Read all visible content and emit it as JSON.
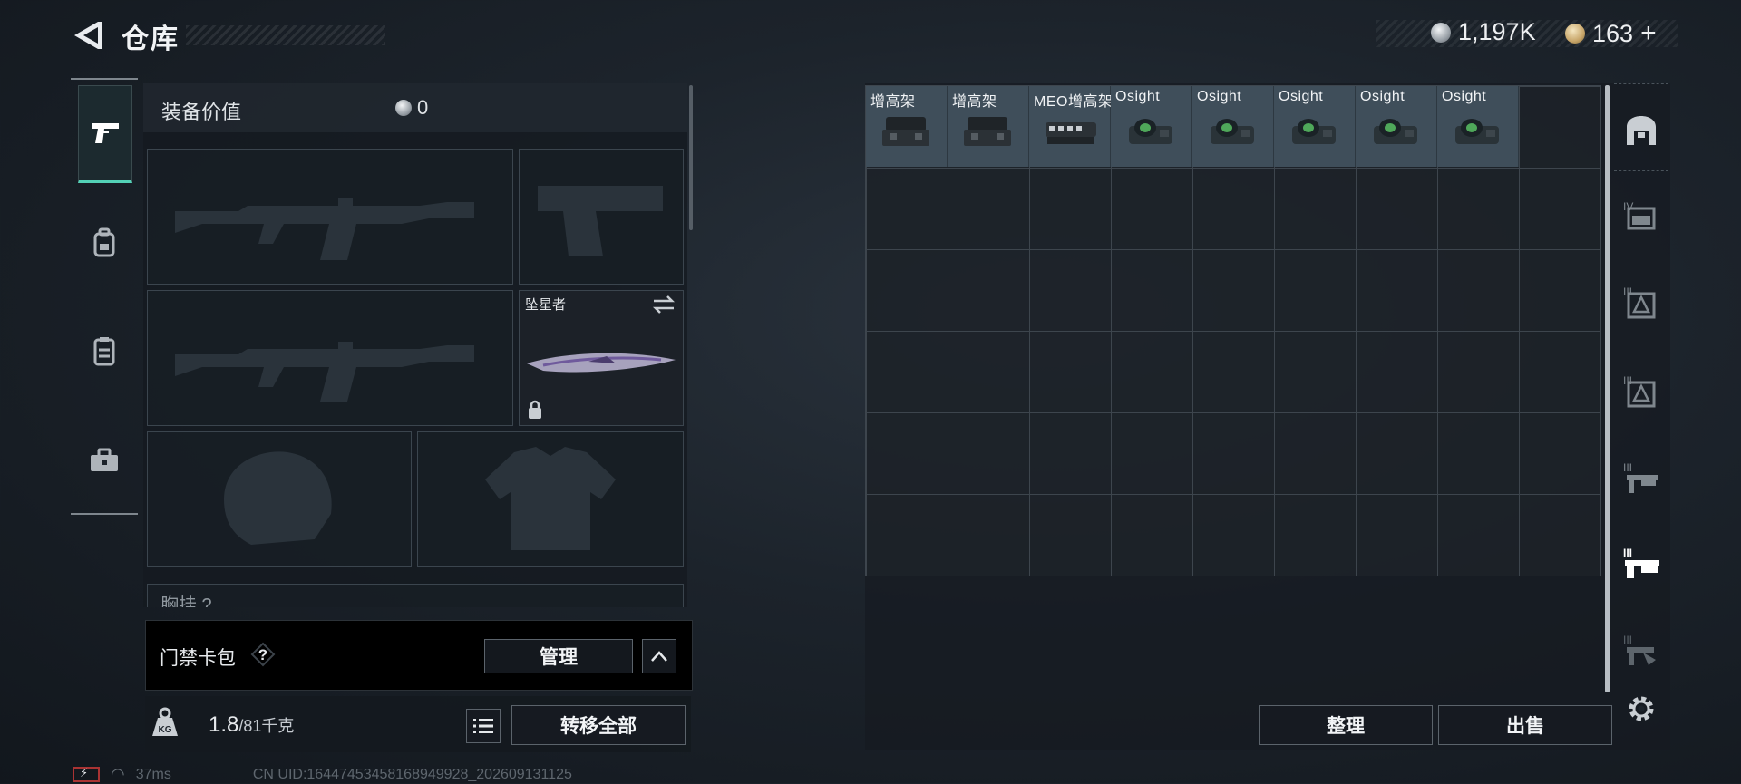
{
  "header": {
    "title": "仓库",
    "currency_silver": "1,197K",
    "currency_gold": "163",
    "gold_plus": "+"
  },
  "equipment": {
    "value_label": "装备价值",
    "value": "0",
    "melee_name": "坠星者",
    "next_section": "胸挂 ?"
  },
  "card_pack": {
    "label": "门禁卡包",
    "help": "?",
    "manage": "管理"
  },
  "weight": {
    "current": "1.8",
    "max": "/81千克",
    "transfer_all": "转移全部"
  },
  "footer": {
    "ping": "37ms",
    "uid": "CN UID:16447453458168949928_202609131125"
  },
  "storage": {
    "items": [
      {
        "name": "增高架",
        "icon": "riser-mount-icon"
      },
      {
        "name": "增高架",
        "icon": "riser-mount-icon"
      },
      {
        "name": "MEO增高架",
        "icon": "meo-riser-icon"
      },
      {
        "name": "Osight",
        "icon": "osight-icon"
      },
      {
        "name": "Osight",
        "icon": "osight-icon"
      },
      {
        "name": "Osight",
        "icon": "osight-icon"
      },
      {
        "name": "Osight",
        "icon": "osight-icon"
      },
      {
        "name": "Osight",
        "icon": "osight-icon"
      }
    ],
    "sort": "整理",
    "sell": "出售"
  },
  "colors": {
    "accent": "#53d1b6",
    "item_bg": "#3f4e5a"
  }
}
